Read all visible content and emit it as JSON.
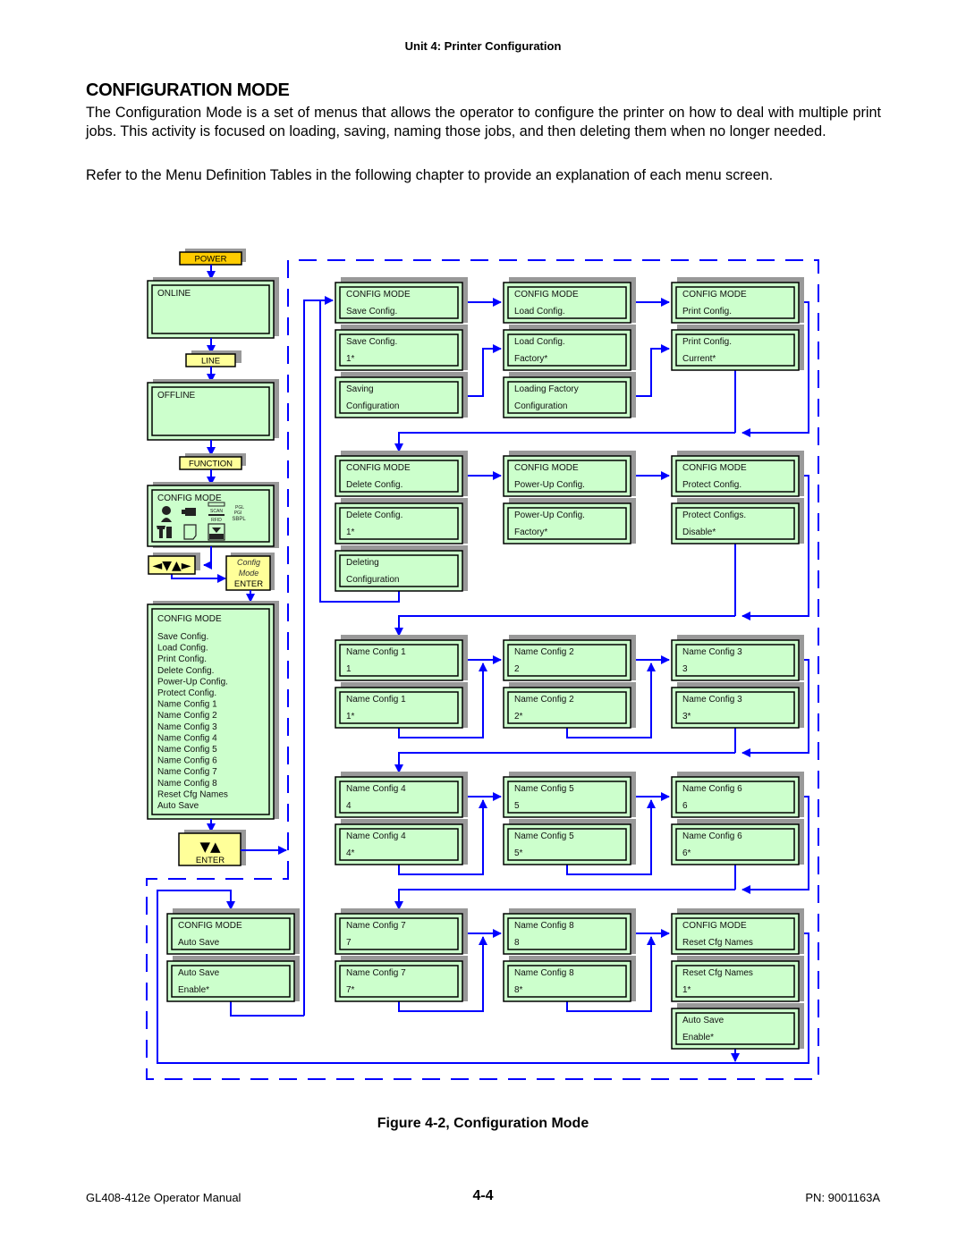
{
  "page": {
    "header": "Unit 4:  Printer Configuration",
    "title": "CONFIGURATION MODE",
    "paragraph1": "The Configuration Mode is a set of menus that allows the operator to configure the printer on how to deal with multiple print jobs. This activity is focused on loading, saving, naming those jobs, and then deleting them when no longer needed.",
    "paragraph2": "Refer to the Menu Definition Tables in the following chapter to provide an explanation of each menu screen.",
    "caption": "Figure 4-2, Configuration Mode",
    "footer_left": "GL408-412e Operator Manual",
    "footer_center": "4-4",
    "footer_right": "PN: 9001163A"
  },
  "colors": {
    "lcd_fill": "#ccffcc",
    "key_fill": "#ffff99",
    "power_key_fill": "#ffcc00",
    "connector": "#0000ff",
    "shadow": "#999999"
  },
  "left_column": {
    "power_key": "POWER",
    "online_screen": "ONLINE",
    "line_key": "LINE",
    "offline_screen": "OFFLINE",
    "function_key": "FUNCTION",
    "menu_screen_title": "CONFIG MODE",
    "menu_icons": [
      "operator-icon",
      "interface-icon",
      "scan-rfid-icon",
      "pgl-pgi-sbpl-icon",
      "tools-icon",
      "page-icon",
      "label-icon"
    ],
    "menu_icon_labels": [
      "SCAN",
      "RFID",
      "PGL",
      "PGI",
      "SBPL"
    ],
    "nav_keys": "◄▼▲►",
    "enter_key": {
      "line1": "Config",
      "line2": "Mode",
      "line3": "ENTER"
    },
    "config_list_title": "CONFIG MODE",
    "config_list": [
      "Save Config.",
      "Load Config.",
      "Print Config.",
      "Delete Config.",
      "Power-Up Config.",
      "Protect Config.",
      "Name Config 1",
      "Name Config 2",
      "Name Config 3",
      "Name Config 4",
      "Name Config 5",
      "Name Config 6",
      "Name Config 7",
      "Name Config 8",
      "Reset Cfg Names",
      "Auto Save"
    ],
    "scroll_enter_key": {
      "arrows": "▼▲",
      "label": "ENTER"
    }
  },
  "screens": [
    {
      "id": "save-config-menu",
      "line1": "CONFIG MODE",
      "line2": "Save Config."
    },
    {
      "id": "save-config-select",
      "line1": "Save Config.",
      "line2": "1*"
    },
    {
      "id": "saving-configuration",
      "line1": "Saving",
      "line2": "Configuration"
    },
    {
      "id": "load-config-menu",
      "line1": "CONFIG MODE",
      "line2": "Load Config."
    },
    {
      "id": "load-config-select",
      "line1": "Load Config.",
      "line2": "Factory*"
    },
    {
      "id": "loading-factory",
      "line1": "Loading Factory",
      "line2": "Configuration"
    },
    {
      "id": "print-config-menu",
      "line1": "CONFIG MODE",
      "line2": "Print Config."
    },
    {
      "id": "print-config-select",
      "line1": "Print Config.",
      "line2": "Current*"
    },
    {
      "id": "delete-config-menu",
      "line1": "CONFIG MODE",
      "line2": "Delete Config."
    },
    {
      "id": "delete-config-select",
      "line1": "Delete Config.",
      "line2": "1*"
    },
    {
      "id": "deleting-configuration",
      "line1": "Deleting",
      "line2": "Configuration"
    },
    {
      "id": "powerup-config-menu",
      "line1": "CONFIG MODE",
      "line2": "Power-Up Config."
    },
    {
      "id": "powerup-config-select",
      "line1": "Power-Up Config.",
      "line2": "Factory*"
    },
    {
      "id": "protect-config-menu",
      "line1": "CONFIG MODE",
      "line2": "Protect Config."
    },
    {
      "id": "protect-config-select",
      "line1": "Protect Configs.",
      "line2": "Disable*"
    },
    {
      "id": "name-config-1",
      "line1": "Name Config 1",
      "line2": "1"
    },
    {
      "id": "name-config-1-select",
      "line1": "Name Config 1",
      "line2": "1*"
    },
    {
      "id": "name-config-2",
      "line1": "Name Config 2",
      "line2": "2"
    },
    {
      "id": "name-config-2-select",
      "line1": "Name Config 2",
      "line2": "2*"
    },
    {
      "id": "name-config-3",
      "line1": "Name Config 3",
      "line2": "3"
    },
    {
      "id": "name-config-3-select",
      "line1": "Name Config 3",
      "line2": "3*"
    },
    {
      "id": "name-config-4",
      "line1": "Name Config 4",
      "line2": "4"
    },
    {
      "id": "name-config-4-select",
      "line1": "Name Config 4",
      "line2": "4*"
    },
    {
      "id": "name-config-5",
      "line1": "Name Config 5",
      "line2": "5"
    },
    {
      "id": "name-config-5-select",
      "line1": "Name Config 5",
      "line2": "5*"
    },
    {
      "id": "name-config-6",
      "line1": "Name Config 6",
      "line2": "6"
    },
    {
      "id": "name-config-6-select",
      "line1": "Name Config 6",
      "line2": "6*"
    },
    {
      "id": "name-config-7",
      "line1": "Name Config 7",
      "line2": "7"
    },
    {
      "id": "name-config-7-select",
      "line1": "Name Config 7",
      "line2": "7*"
    },
    {
      "id": "name-config-8",
      "line1": "Name Config 8",
      "line2": "8"
    },
    {
      "id": "name-config-8-select",
      "line1": "Name Config 8",
      "line2": "8*"
    },
    {
      "id": "reset-cfg-names-menu",
      "line1": "CONFIG MODE",
      "line2": "Reset Cfg Names"
    },
    {
      "id": "reset-cfg-names-select",
      "line1": "Reset Cfg Names",
      "line2": "1*"
    },
    {
      "id": "auto-save-final",
      "line1": "Auto Save",
      "line2": "Enable*"
    },
    {
      "id": "auto-save-menu",
      "line1": "CONFIG MODE",
      "line2": "Auto Save"
    },
    {
      "id": "auto-save-select",
      "line1": "Auto Save",
      "line2": "Enable*"
    }
  ]
}
